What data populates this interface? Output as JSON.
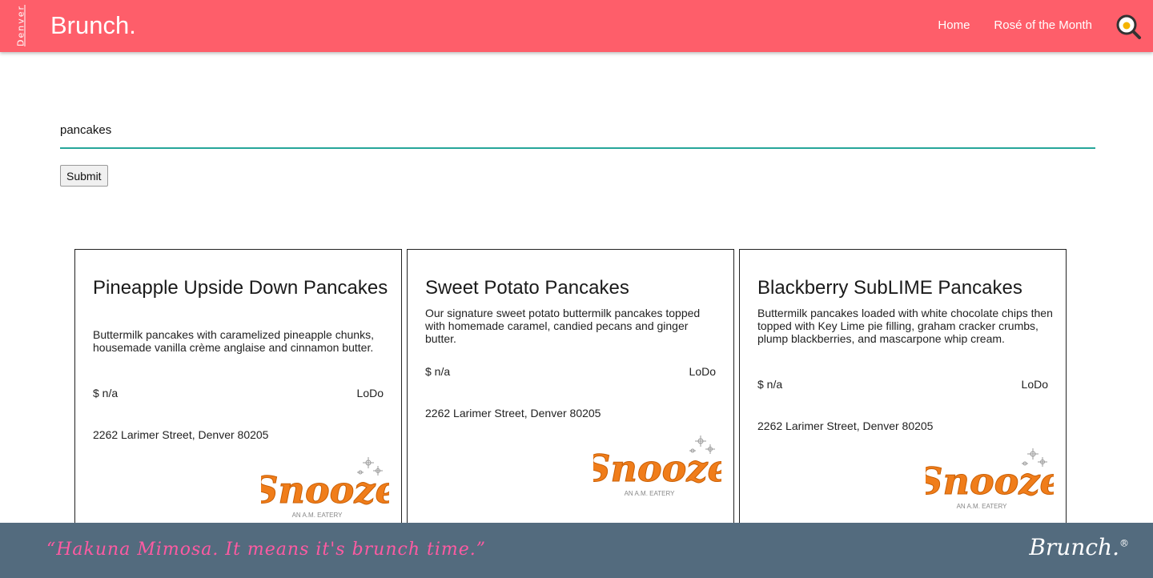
{
  "header": {
    "city": "Denver",
    "brand": "Brunch.",
    "nav": {
      "home": "Home",
      "rose": "Rosé of the Month"
    },
    "search_icon": "magnifier-egg-icon",
    "accent_color": "#fe5e6a"
  },
  "search": {
    "value": "pancakes",
    "submit_label": "Submit",
    "underline_color": "#26a69a"
  },
  "cards": [
    {
      "title": "Pineapple Upside Down Pancakes",
      "description": "Buttermilk pancakes with caramelized pineapple chunks, housemade vanilla crème anglaise and cinnamon butter.",
      "price": "$ n/a",
      "neighborhood": "LoDo",
      "address": "2262 Larimer Street, Denver 80205",
      "logo": {
        "name": "Snooze",
        "tagline": "AN A.M. EATERY"
      }
    },
    {
      "title": "Sweet Potato Pancakes",
      "description": "Our signature sweet potato buttermilk pancakes topped with homemade caramel, candied pecans and ginger butter.",
      "price": "$ n/a",
      "neighborhood": "LoDo",
      "address": "2262 Larimer Street, Denver 80205",
      "logo": {
        "name": "Snooze",
        "tagline": "AN A.M. EATERY"
      }
    },
    {
      "title": "Blackberry SubLIME Pancakes",
      "description": "Buttermilk pancakes loaded with white chocolate chips then topped with Key Lime pie filling, graham cracker crumbs, plump blackberries, and mascarpone whip cream.",
      "price": "$ n/a",
      "neighborhood": "LoDo",
      "address": "2262 Larimer Street, Denver 80205",
      "logo": {
        "name": "Snooze",
        "tagline": "AN A.M. EATERY"
      }
    }
  ],
  "footer": {
    "quote": "“Hakuna Mimosa. It means it's brunch time.”",
    "brand": "Brunch.",
    "registered": "®",
    "background": "#536b7e",
    "quote_color": "#ff5aa2"
  }
}
